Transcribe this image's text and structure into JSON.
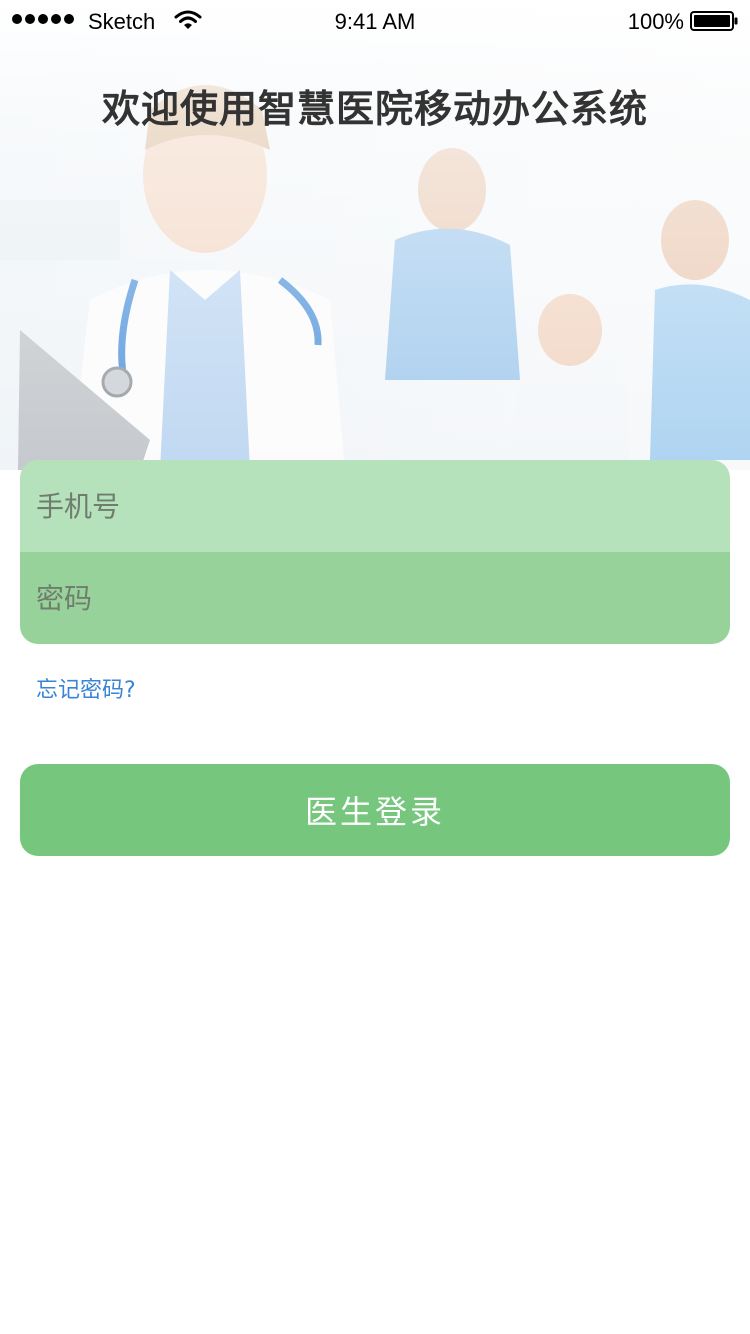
{
  "status_bar": {
    "carrier": "Sketch",
    "time": "9:41 AM",
    "battery": "100%",
    "icons": [
      "signal-dots-icon",
      "wifi-icon",
      "battery-icon"
    ]
  },
  "title": "欢迎使用智慧医院移动办公系统",
  "form": {
    "phone_placeholder": "手机号",
    "phone_value": "",
    "password_placeholder": "密码",
    "password_value": ""
  },
  "forgot_password": "忘记密码?",
  "login_button": "医生登录",
  "colors": {
    "title": "#333333",
    "phone_field_bg": "#b6e2bb",
    "password_field_bg": "#98d29b",
    "login_button_bg": "#76c77d",
    "link": "#3a84d6"
  }
}
